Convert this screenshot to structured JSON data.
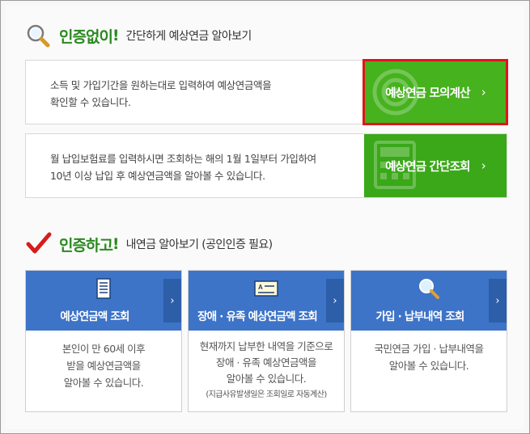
{
  "section_no_cert": {
    "title_strong": "인증없이",
    "title_excl": "!",
    "subtitle": "간단하게 예상연금 알아보기",
    "icon": "magnifier-icon",
    "rows": [
      {
        "desc_line1": "소득 및 가입기간을 원하는대로 입력하여 예상연금액을",
        "desc_line2": "확인할 수 있습니다.",
        "button_label": "예상연금 모의계산",
        "chevron": "›"
      },
      {
        "desc_line1": "월 납입보험료를 입력하시면 조회하는 해의 1월 1일부터 가입하여",
        "desc_line2": "10년 이상 납입 후 예상연금액을 알아볼 수 있습니다.",
        "button_label": "예상연금 간단조회",
        "chevron": "›"
      }
    ]
  },
  "section_cert": {
    "title_strong": "인증하고",
    "title_excl": "!",
    "subtitle": "내연금 알아보기 (공인인증 필요)",
    "icon": "checkmark-icon",
    "cards": [
      {
        "title": "예상연금액 조회",
        "icon": "document-icon",
        "chevron": "›",
        "body_line1": "본인이 만 60세 이후",
        "body_line2": "받을 예상연금액을",
        "body_line3": "알아볼 수 있습니다."
      },
      {
        "title": "장애 · 유족 예상연금액 조회",
        "icon": "id-card-icon",
        "chevron": "›",
        "body_line1": "현재까지 납부한 내역을 기준으로",
        "body_line2": "장애 · 유족 예상연금액을",
        "body_line3": "알아볼 수 있습니다.",
        "note": "(지급사유발생일은 조회일로 자동계산)"
      },
      {
        "title": "가입 · 납부내역 조회",
        "icon": "search-icon",
        "chevron": "›",
        "body_line1": "국민연금 가입 · 납부내역을",
        "body_line2": "알아볼 수 있습니다."
      }
    ]
  },
  "colors": {
    "green_title": "#2a8a1f",
    "green_button": "#3aa819",
    "highlight_border": "#e0141b",
    "blue_card": "#3d74c8",
    "blue_tab": "#2d5ea8"
  }
}
